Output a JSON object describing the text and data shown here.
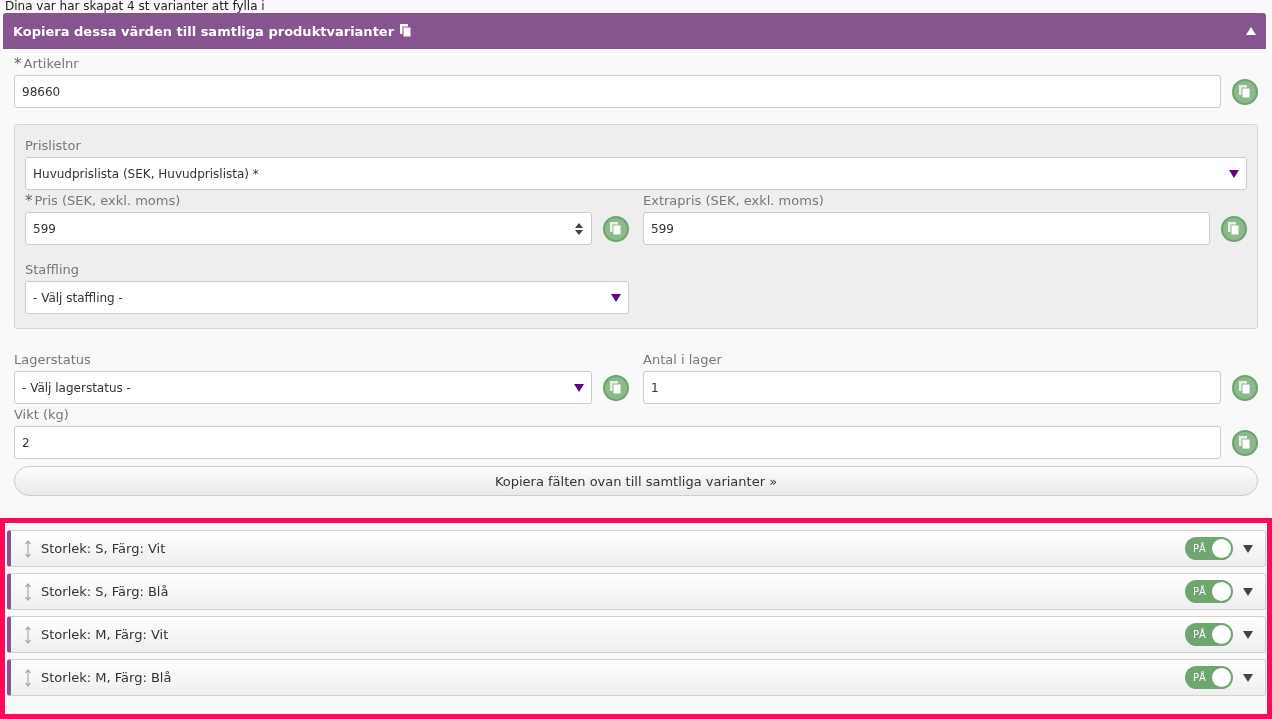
{
  "intro": "Dina var har skapat 4 st varianter att fylla i",
  "panel": {
    "title": "Kopiera dessa värden till samtliga produktvarianter",
    "expanded": true
  },
  "article": {
    "label": "Artikelnr",
    "required_mark": "*",
    "value": "98660"
  },
  "pricebox": {
    "pricelist": {
      "label": "Prislistor",
      "value": "Huvudprislista (SEK, Huvudprislista) *"
    },
    "price": {
      "label": "Pris (SEK, exkl. moms)",
      "required_mark": "*",
      "value": "599"
    },
    "extra": {
      "label": "Extrapris (SEK, exkl. moms)",
      "value": "599"
    },
    "tier": {
      "label": "Staffling",
      "value": "- Välj staffling -"
    }
  },
  "stock_status": {
    "label": "Lagerstatus",
    "value": "- Välj lagerstatus -"
  },
  "stock_count": {
    "label": "Antal i lager",
    "value": "1"
  },
  "weight": {
    "label": "Vikt (kg)",
    "value": "2"
  },
  "copy_button": "Kopiera fälten ovan till samtliga varianter »",
  "variants": [
    {
      "title": "Storlek: S, Färg: Vit",
      "toggle": "PÅ",
      "on": true,
      "expanded": false
    },
    {
      "title": "Storlek: S, Färg: Blå",
      "toggle": "PÅ",
      "on": true,
      "expanded": false
    },
    {
      "title": "Storlek: M, Färg: Vit",
      "toggle": "PÅ",
      "on": true,
      "expanded": false
    },
    {
      "title": "Storlek: M, Färg: Blå",
      "toggle": "PÅ",
      "on": true,
      "expanded": false
    }
  ]
}
